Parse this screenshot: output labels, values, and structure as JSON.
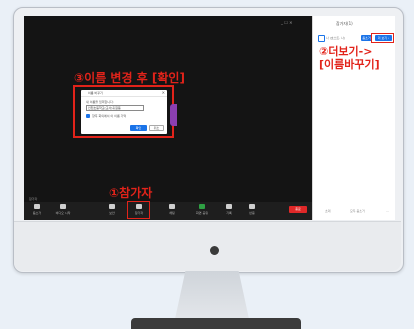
{
  "annotations": {
    "rename_confirm": "③이름 변경 후 [확인]",
    "participants": "①참가자",
    "more_rename_line1": "②더보기->",
    "more_rename_line2": "[이름바꾸기]"
  },
  "screen": {
    "window_controls": "_ ☐ ✕",
    "participant_count_label": "참가자"
  },
  "dialog": {
    "title": "이름 바꾸기",
    "close": "✕",
    "prompt": "새 이름을 입력합니다:",
    "input_value": "인천초등학교(교사)홍길동",
    "checkbox_label": "향후 회의에서 이 이름 기억",
    "ok_label": "확인",
    "cancel_label": "취소"
  },
  "toolbar": {
    "items": [
      {
        "label": "음소거",
        "icon": "microphone-icon"
      },
      {
        "label": "비디오 시작",
        "icon": "video-camera-icon"
      },
      {
        "label": "보안",
        "icon": "shield-icon"
      },
      {
        "label": "참가자",
        "icon": "participants-icon"
      },
      {
        "label": "채팅",
        "icon": "chat-icon"
      },
      {
        "label": "화면 공유",
        "icon": "share-screen-icon"
      },
      {
        "label": "기록",
        "icon": "record-icon"
      },
      {
        "label": "반응",
        "icon": "reactions-icon"
      }
    ],
    "end_label": "종료"
  },
  "side_panel": {
    "title": "참가자(1)",
    "username": "나 (호스트, 나)",
    "mute_btn": "음소거",
    "more_btn": "더 보기 ›",
    "footer": {
      "invite": "초대",
      "mute_all": "모두 음소거",
      "more": "..."
    }
  },
  "colors": {
    "annotation_red": "#e2231a",
    "zoom_blue": "#1a73e8",
    "end_red": "#e02828"
  }
}
